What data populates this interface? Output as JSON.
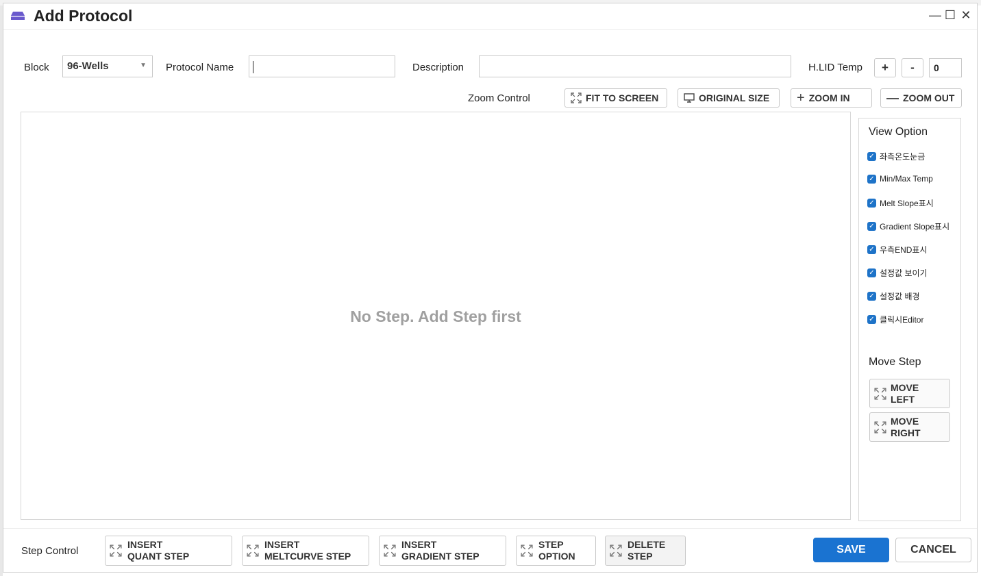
{
  "dialog": {
    "title": "Add Protocol",
    "controls": {
      "minimize": "—",
      "maximize": "☐",
      "close": "✕"
    }
  },
  "form": {
    "block_label": "Block",
    "block_value": "96-Wells",
    "protocol_name_label": "Protocol Name",
    "protocol_name_value": "",
    "description_label": "Description",
    "description_value": "",
    "hlid_label": "H.LID Temp",
    "hlid_plus": "+",
    "hlid_minus": "-",
    "hlid_value": "0"
  },
  "zoom": {
    "label": "Zoom Control",
    "fit": "FIT TO SCREEN",
    "original": "ORIGINAL SIZE",
    "zoom_in": "ZOOM IN",
    "zoom_out": "ZOOM OUT"
  },
  "canvas": {
    "empty_message": "No Step. Add Step first"
  },
  "view_option": {
    "title": "View Option",
    "items": [
      {
        "label": "좌측온도눈금",
        "checked": true
      },
      {
        "label": "Min/Max Temp",
        "checked": true
      },
      {
        "label": "Melt Slope표시",
        "checked": true
      },
      {
        "label": "Gradient Slope표시",
        "checked": true
      },
      {
        "label": "우측END표시",
        "checked": true
      },
      {
        "label": "설정값 보이기",
        "checked": true
      },
      {
        "label": "설정값 배경",
        "checked": true
      },
      {
        "label": "클릭시Editor",
        "checked": true
      }
    ]
  },
  "move_step": {
    "title": "Move Step",
    "left_1": "MOVE",
    "left_2": "LEFT",
    "right_1": "MOVE",
    "right_2": "RIGHT"
  },
  "step_control": {
    "label": "Step Control",
    "buttons": [
      {
        "line1": "INSERT",
        "line2": "QUANT STEP"
      },
      {
        "line1": "INSERT",
        "line2": "MELTCURVE STEP"
      },
      {
        "line1": "INSERT",
        "line2": "GRADIENT STEP"
      },
      {
        "line1": "STEP",
        "line2": "OPTION"
      },
      {
        "line1": "DELETE",
        "line2": "STEP"
      }
    ]
  },
  "actions": {
    "save": "SAVE",
    "cancel": "CANCEL"
  },
  "colors": {
    "accent": "#1a73d1",
    "checkbox": "#1e73c8",
    "icon": "#6a5acd"
  }
}
